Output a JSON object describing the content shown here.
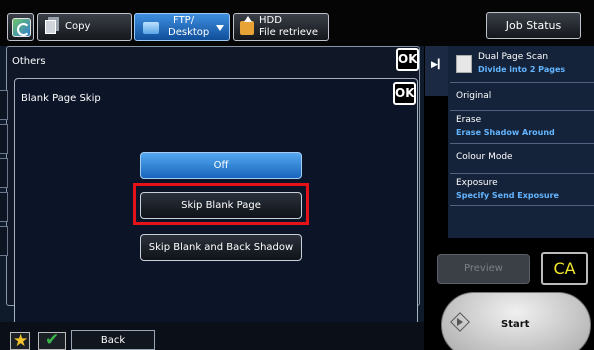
{
  "tabs": {
    "copy": "Copy",
    "ftp_line1": "FTP/",
    "ftp_line2": "Desktop",
    "hdd_line1": "HDD",
    "hdd_line2": "File retrieve",
    "job_status": "Job Status"
  },
  "others": {
    "title": "Others",
    "ok": "OK"
  },
  "blank_page_skip": {
    "title": "Blank Page Skip",
    "ok": "OK",
    "options": [
      "Off",
      "Skip Blank Page",
      "Skip Blank and Back Shadow"
    ],
    "selected_option": "Off",
    "highlighted_option": "Skip Blank Page"
  },
  "bottom": {
    "back": "Back"
  },
  "right_panel": {
    "dual_page_scan": "Dual Page Scan",
    "dual_page_scan_value": "Divide into 2 Pages",
    "original": "Original",
    "erase": "Erase",
    "erase_value": "Erase Shadow Around",
    "colour_mode": "Colour Mode",
    "exposure": "Exposure",
    "exposure_value": "Specify Send Exposure"
  },
  "actions": {
    "preview": "Preview",
    "ca": "CA",
    "start": "Start"
  },
  "colors": {
    "accent_blue": "#1f78d1",
    "highlight_red": "#e5121a",
    "value_blue": "#63b5ff",
    "ca_yellow": "#f2e529"
  }
}
